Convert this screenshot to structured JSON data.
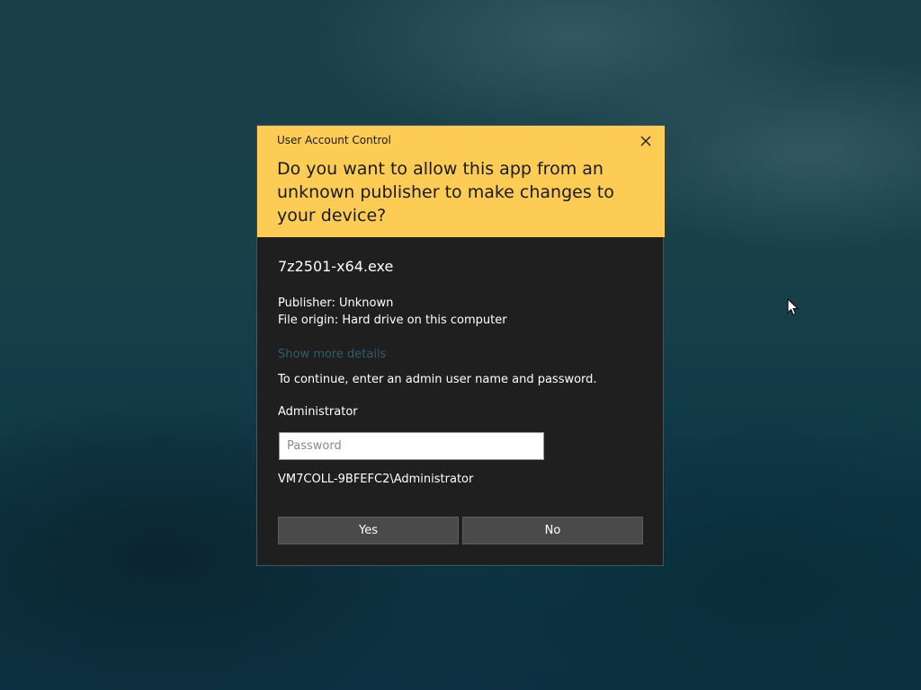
{
  "dialog": {
    "title": "User Account Control",
    "question": "Do you want to allow this app from an unknown publisher to make changes to your device?",
    "app_name": "7z2501-x64.exe",
    "publisher": "Publisher: Unknown",
    "file_origin": "File origin: Hard drive on this computer",
    "show_more_details": "Show more details",
    "instructions": "To continue, enter an admin user name and password.",
    "username": "Administrator",
    "password_placeholder": "Password",
    "password_value": "",
    "domain_user": "VM7COLL-9BFEFC2\\Administrator",
    "yes_label": "Yes",
    "no_label": "No",
    "close_icon": "close-icon"
  },
  "colors": {
    "header_background": "#fccc54",
    "body_background": "#1f1f1f",
    "button_background": "#4a4a4a",
    "link_color": "#2f5d68"
  },
  "cursor_icon": "mouse-pointer-icon"
}
